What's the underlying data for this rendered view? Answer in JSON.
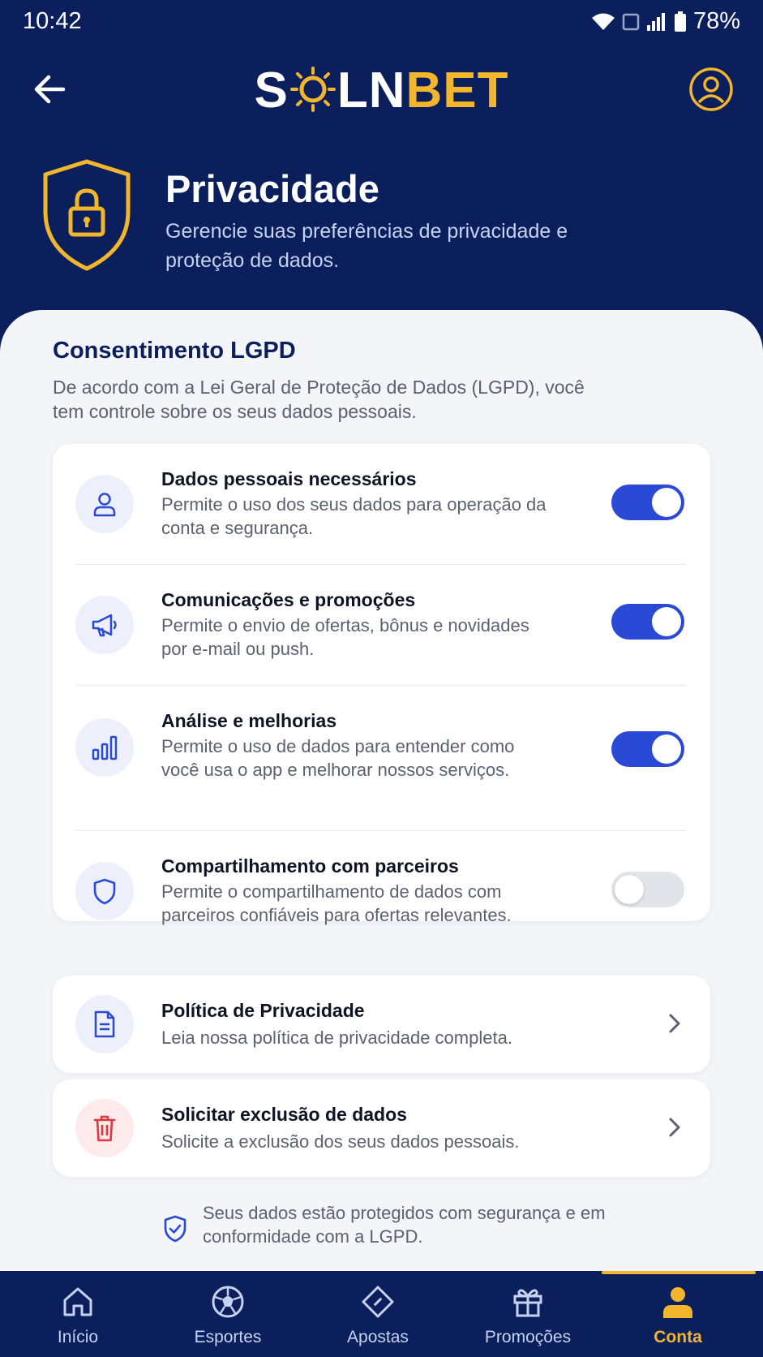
{
  "status_bar": {
    "time": "10:42",
    "battery": "78%"
  },
  "app_bar": {
    "logo_white_1": "S",
    "logo_white_2": "LN",
    "logo_yellow": "BET"
  },
  "hero": {
    "title": "Privacidade",
    "subtitle": "Gerencie suas preferências de privacidade e proteção de dados."
  },
  "consent": {
    "title": "Consentimento LGPD",
    "description": "De acordo com a Lei Geral de Proteção de Dados (LGPD), você tem controle sobre os seus dados pessoais.",
    "items": [
      {
        "title": "Dados pessoais necessários",
        "description": "Permite o uso dos seus dados para operação da conta e segurança.",
        "icon": "user-icon",
        "enabled": true
      },
      {
        "title": "Comunicações e promoções",
        "description": "Permite o envio de ofertas, bônus e novidades por e-mail ou push.",
        "icon": "megaphone-icon",
        "enabled": true
      },
      {
        "title": "Análise e melhorias",
        "description": "Permite o uso de dados para entender como você usa o app e melhorar nossos serviços.",
        "icon": "bar-chart-icon",
        "enabled": true
      },
      {
        "title": "Compartilhamento com parceiros",
        "description": "Permite o compartilhamento de dados com parceiros confiáveis para ofertas relevantes.",
        "icon": "shield-icon",
        "enabled": false
      }
    ]
  },
  "links": [
    {
      "title": "Política de Privacidade",
      "description": "Leia nossa política de privacidade completa.",
      "icon": "document-icon"
    },
    {
      "title": "Solicitar exclusão de dados",
      "description": "Solicite a exclusão dos seus dados pessoais.",
      "icon": "trash-icon"
    }
  ],
  "footer_note": "Seus dados estão protegidos com segurança e em conformidade com a LGPD.",
  "bottom_nav": {
    "items": [
      {
        "label": "Início",
        "icon": "home-icon"
      },
      {
        "label": "Esportes",
        "icon": "soccer-ball-icon"
      },
      {
        "label": "Apostas",
        "icon": "ticket-icon"
      },
      {
        "label": "Promoções",
        "icon": "gift-icon"
      },
      {
        "label": "Conta",
        "icon": "user-filled-icon"
      }
    ],
    "active_index": 4
  },
  "colors": {
    "navy": "#0b1f5c",
    "accent_yellow": "#f2b62c",
    "toggle_on": "#2a4ad6",
    "danger": "#e0383e"
  }
}
